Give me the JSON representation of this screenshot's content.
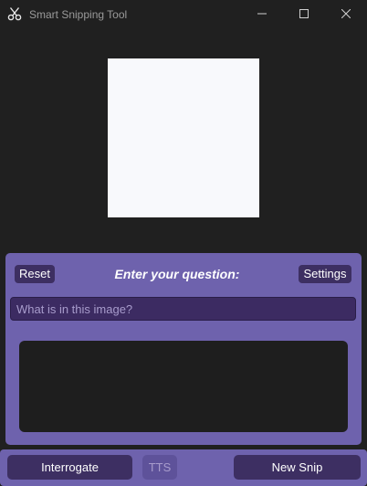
{
  "window": {
    "title": "Smart Snipping Tool",
    "icon": "scissors-icon"
  },
  "controls": {
    "minimize_icon": "minimize-icon",
    "maximize_icon": "maximize-icon",
    "close_icon": "close-icon"
  },
  "panel": {
    "reset_label": "Reset",
    "title": "Enter your question:",
    "settings_label": "Settings",
    "question_placeholder": "What is in this image?",
    "question_value": "",
    "answer_text": ""
  },
  "bottom": {
    "interrogate_label": "Interrogate",
    "tts_label": "TTS",
    "new_snip_label": "New Snip"
  },
  "colors": {
    "panel": "#6e62ad",
    "button": "#3d2f62",
    "background": "#202020",
    "answer_bg": "#1e1e1e"
  }
}
